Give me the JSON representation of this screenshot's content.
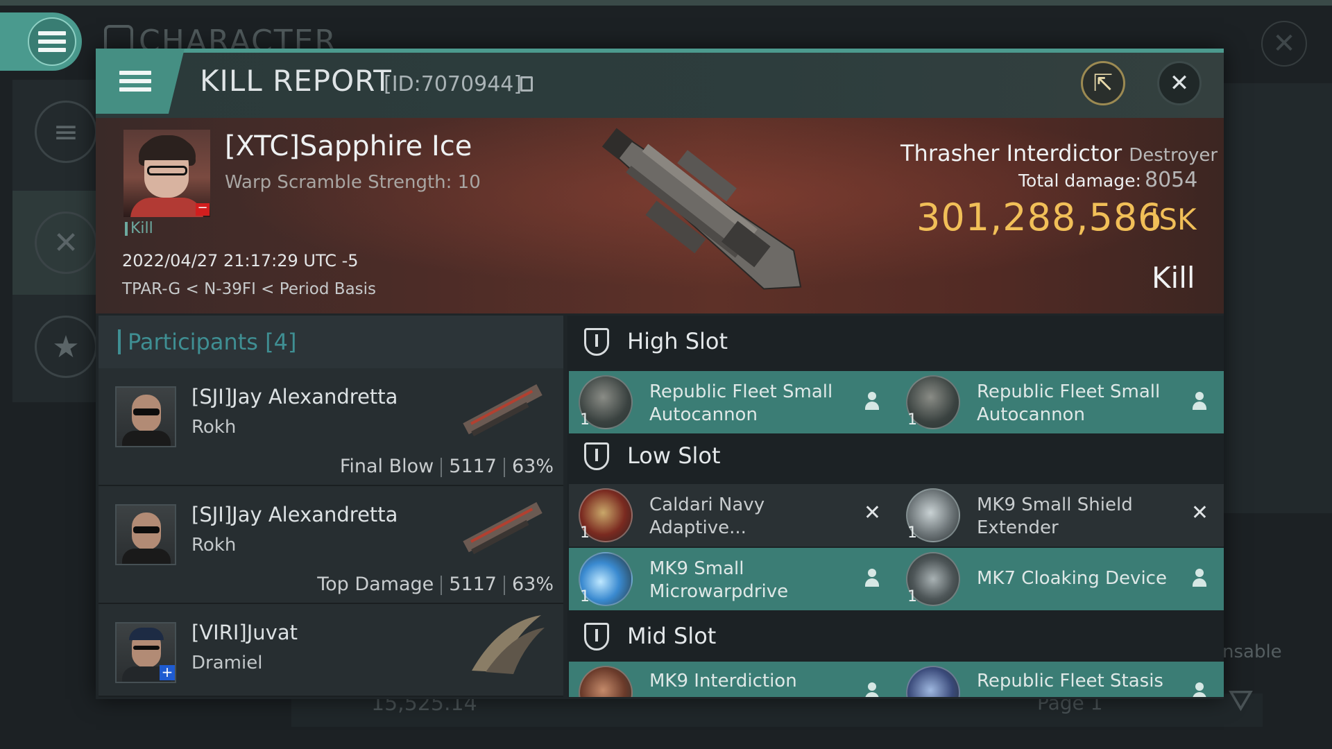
{
  "background": {
    "window_title": "CHARACTER",
    "right_text": "nsable",
    "bottom_value": "15,525.14",
    "bottom_page": "Page 1"
  },
  "header": {
    "title": "KILL REPORT",
    "report_id": "[ID:7070944]"
  },
  "victim": {
    "name": "[XTC]Sapphire Ice",
    "subtitle": "Warp Scramble Strength: 10",
    "tag": "Kill",
    "datetime": "2022/04/27 21:17:29 UTC -5",
    "location": "TPAR-G < N-39FI < Period Basis",
    "ship_name": "Thrasher Interdictor",
    "ship_class": "Destroyer",
    "damage_label": "Total damage:",
    "damage_value": "8054",
    "isk_value": "301,288,586",
    "isk_unit": "ISK",
    "result": "Kill"
  },
  "participants": {
    "title": "Participants [4]",
    "rows": [
      {
        "name": "[SJI]Jay Alexandretta",
        "ship": "Rokh",
        "role": "Final Blow",
        "damage": "5117",
        "percent": "63%"
      },
      {
        "name": "[SJI]Jay Alexandretta",
        "ship": "Rokh",
        "role": "Top Damage",
        "damage": "5117",
        "percent": "63%"
      },
      {
        "name": "[VIRI]Juvat",
        "ship": "Dramiel"
      }
    ]
  },
  "fitting": {
    "high": {
      "title": "High Slot",
      "modules": [
        {
          "name": "Republic Fleet Small Autocannon",
          "qty": "1",
          "status": "fitted"
        },
        {
          "name": "Republic Fleet Small Autocannon",
          "qty": "1",
          "status": "fitted"
        }
      ]
    },
    "low": {
      "title": "Low Slot",
      "modules": [
        {
          "name": "Caldari Navy Adaptive...",
          "qty": "1",
          "status": "dropped"
        },
        {
          "name": "MK9 Small Shield Extender",
          "qty": "1",
          "status": "dropped"
        },
        {
          "name": "MK9 Small Microwarpdrive",
          "qty": "1",
          "status": "fitted"
        },
        {
          "name": "MK7 Cloaking Device",
          "qty": "1",
          "status": "fitted"
        }
      ]
    },
    "mid": {
      "title": "Mid Slot",
      "modules": [
        {
          "name": "MK9 Interdiction",
          "status": "fitted"
        },
        {
          "name": "Republic Fleet Stasis",
          "status": "fitted"
        }
      ]
    }
  },
  "colors": {
    "accent_teal": "#3b7d75",
    "isk_gold": "#f1bf58",
    "banner_red": "#5e3128",
    "participants_title": "#3f8f93"
  },
  "icons": [
    "hamburger-menu-icon",
    "share-icon",
    "close-icon",
    "copy-icon",
    "slot-icon",
    "person-icon",
    "x-icon",
    "star-icon",
    "swords-icon",
    "filter-icon"
  ]
}
